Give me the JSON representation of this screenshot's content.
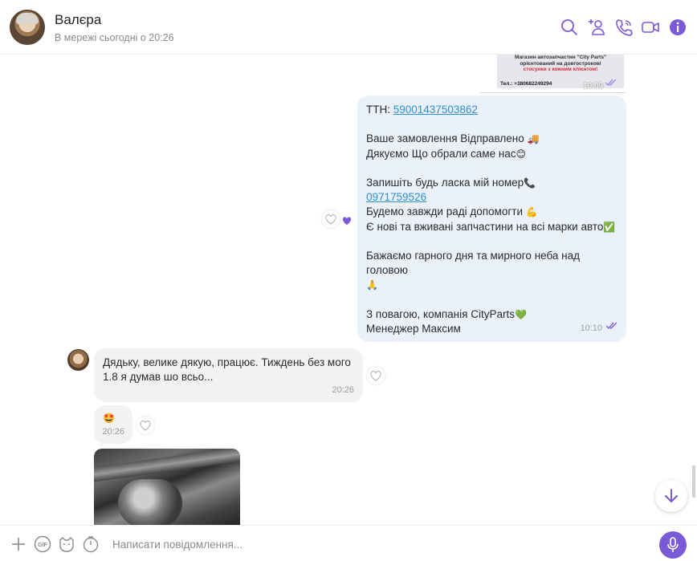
{
  "header": {
    "contact_name": "Валєра",
    "status": "В мережі сьогодні о 20:26",
    "icons": [
      "search-icon",
      "add-contact-icon",
      "call-icon",
      "video-call-icon",
      "info-icon"
    ],
    "accent_color": "#7b5ad8"
  },
  "image_message": {
    "caption_lines": [
      "Магазин автозапчастин \"City Parts\"",
      "орієнтований на довгострокові",
      "стосунки з кожним клієнтом!"
    ],
    "phone": "Тел.: +380682249294",
    "time": "10:09"
  },
  "outgoing_message": {
    "ttn_label": "ТТН: ",
    "ttn_number": "59001437503862",
    "line_sent": "Ваше замовлення Відправлено",
    "line_thanks": "Дякуємо Що обрали саме нас",
    "line_save_number": "Запишіть будь ласка мій номер",
    "phone_link": "0971759526",
    "line_help": "Будемо завжди раді допомогти",
    "line_parts": "Є нові та вживані запчастини на всі марки авто",
    "line_wish": "Бажаємо гарного дня та мирного неба над головою",
    "line_regards": "З повагою, компанія CityParts",
    "line_manager": "Менеджер Максим",
    "time": "10:10",
    "emojis": {
      "truck": "🚚",
      "smile": "😊",
      "phone": "📞",
      "muscle": "💪",
      "check": "✅",
      "pray": "🙏",
      "heart": "💚"
    }
  },
  "incoming_messages": [
    {
      "text": "Дядьку, велике дякую, працює. Тиждень без мого 1.8 я думав шо всьо...",
      "time": "20:26"
    },
    {
      "text": "🤩",
      "time": "20:26"
    }
  ],
  "composer": {
    "placeholder": "Написати повідомлення...",
    "gif_label": "GIF"
  }
}
